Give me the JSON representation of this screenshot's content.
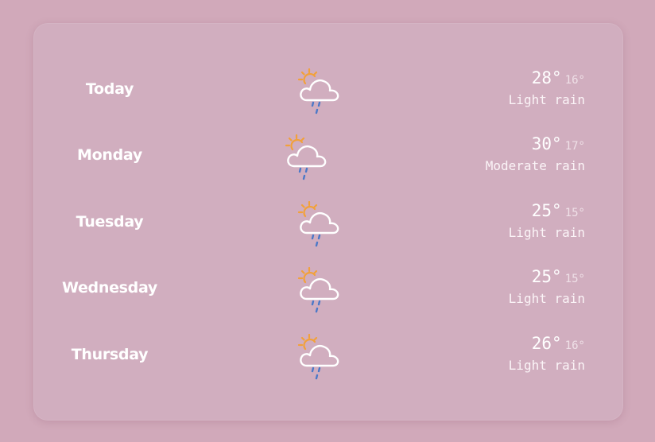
{
  "forecast": {
    "days": [
      {
        "day": "Today",
        "icon": "partly-sunny-rain-icon",
        "high": "28°",
        "low": "16°",
        "condition": "Light rain"
      },
      {
        "day": "Monday",
        "icon": "partly-sunny-rain-icon",
        "high": "30°",
        "low": "17°",
        "condition": "Moderate rain"
      },
      {
        "day": "Tuesday",
        "icon": "partly-sunny-rain-icon",
        "high": "25°",
        "low": "15°",
        "condition": "Light rain"
      },
      {
        "day": "Wednesday",
        "icon": "partly-sunny-rain-icon",
        "high": "25°",
        "low": "15°",
        "condition": "Light rain"
      },
      {
        "day": "Thursday",
        "icon": "partly-sunny-rain-icon",
        "high": "26°",
        "low": "16°",
        "condition": "Light rain"
      }
    ]
  },
  "colors": {
    "background": "#d1a9ba",
    "panel": "#d1aebf",
    "sun": "#f2a13a",
    "rain": "#4a78c8",
    "text": "#ffffff"
  }
}
